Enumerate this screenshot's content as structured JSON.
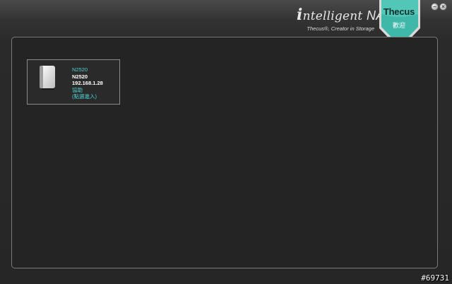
{
  "header": {
    "brand_i": "i",
    "brand_rest": "ntelligent",
    "brand_nas": "NAS",
    "tagline": "Thecus®, Creator in Storage",
    "logo_text": "Thecus",
    "logo_sub": "歡迎",
    "minimize_symbol": "–",
    "close_symbol": "×"
  },
  "devices": [
    {
      "model_link": "N2520",
      "hostname": "N2520",
      "ip": "192.168.1.28",
      "help": "協助",
      "login": "(點選進入)"
    }
  ],
  "watermark": "#69731",
  "colors": {
    "accent": "#4fd1d1",
    "logo_teal": "#3fb7a9"
  },
  "icons": [
    "nas-device-icon",
    "thecus-logo-shield",
    "minimize-icon",
    "close-icon"
  ]
}
